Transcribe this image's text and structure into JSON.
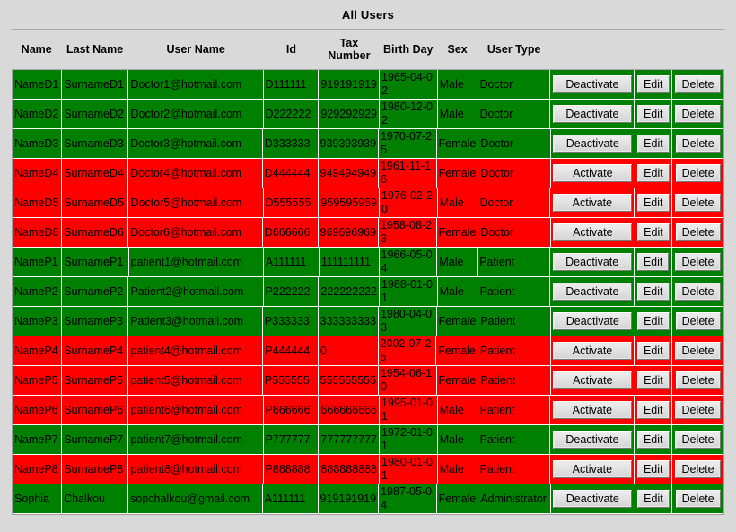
{
  "window": {
    "title": "All Users"
  },
  "colors": {
    "active_row": "#008000",
    "inactive_row": "#ff0000",
    "page_background": "#d9d9d9",
    "button_face": "#d4d0c8"
  },
  "table": {
    "columns": [
      {
        "key": "name",
        "label": "Name"
      },
      {
        "key": "last_name",
        "label": "Last Name"
      },
      {
        "key": "user_name",
        "label": "User Name"
      },
      {
        "key": "id",
        "label": "Id"
      },
      {
        "key": "tax",
        "label": "Tax Number"
      },
      {
        "key": "birth",
        "label": "Birth Day"
      },
      {
        "key": "sex",
        "label": "Sex"
      },
      {
        "key": "user_type",
        "label": "User Type"
      },
      {
        "key": "activate",
        "label": ""
      },
      {
        "key": "edit",
        "label": ""
      },
      {
        "key": "delete",
        "label": ""
      }
    ],
    "labels": {
      "activate": "Activate",
      "deactivate": "Deactivate",
      "edit": "Edit",
      "delete": "Delete"
    },
    "rows": [
      {
        "name": "NameD1",
        "last_name": "SurnameD1",
        "user_name": "Doctor1@hotmail.com",
        "id": "D111111",
        "tax": "919191919",
        "birth": "1965-04-02",
        "sex": "Male",
        "user_type": "Doctor",
        "status": "active",
        "action_label": "Deactivate"
      },
      {
        "name": "NameD2",
        "last_name": "SurnameD2",
        "user_name": "Doctor2@hotmail.com",
        "id": "D222222",
        "tax": "929292929",
        "birth": "1980-12-02",
        "sex": "Male",
        "user_type": "Doctor",
        "status": "active",
        "action_label": "Deactivate"
      },
      {
        "name": "NameD3",
        "last_name": "SurnameD3",
        "user_name": "Doctor3@hotmail.com",
        "id": "D333333",
        "tax": "939393939",
        "birth": "1970-07-25",
        "sex": "Female",
        "user_type": "Doctor",
        "status": "active",
        "action_label": "Deactivate"
      },
      {
        "name": "NameD4",
        "last_name": "SurnameD4",
        "user_name": "Doctor4@hotmail.com",
        "id": "D444444",
        "tax": "949494949",
        "birth": "1961-11-16",
        "sex": "Female",
        "user_type": "Doctor",
        "status": "inactive",
        "action_label": "Activate"
      },
      {
        "name": "NameD5",
        "last_name": "SurnameD5",
        "user_name": "Doctor5@hotmail.com",
        "id": "D555555",
        "tax": "959595959",
        "birth": "1976-02-20",
        "sex": "Male",
        "user_type": "Doctor",
        "status": "inactive",
        "action_label": "Activate"
      },
      {
        "name": "NameD6",
        "last_name": "SurnameD6",
        "user_name": "Doctor6@hotmail.com",
        "id": "D666666",
        "tax": "969696969",
        "birth": "1958-08-23",
        "sex": "Female",
        "user_type": "Doctor",
        "status": "inactive",
        "action_label": "Activate"
      },
      {
        "name": "NameP1",
        "last_name": "SurnameP1",
        "user_name": "patient1@hotmail.com",
        "id": "A111111",
        "tax": "111111111",
        "birth": "1966-05-04",
        "sex": "Male",
        "user_type": "Patient",
        "status": "active",
        "action_label": "Deactivate"
      },
      {
        "name": "NameP2",
        "last_name": "SurnameP2",
        "user_name": "Patient2@hotmail.com",
        "id": "P222222",
        "tax": "222222222",
        "birth": "1988-01-01",
        "sex": "Male",
        "user_type": "Patient",
        "status": "active",
        "action_label": "Deactivate"
      },
      {
        "name": "NameP3",
        "last_name": "SurnameP3",
        "user_name": "Patient3@hotmail.com",
        "id": "P333333",
        "tax": "333333333",
        "birth": "1980-04-03",
        "sex": "Female",
        "user_type": "Patient",
        "status": "active",
        "action_label": "Deactivate"
      },
      {
        "name": "NameP4",
        "last_name": "SurnameP4",
        "user_name": "patient4@hotmail.com",
        "id": "P444444",
        "tax": "0",
        "birth": "2002-07-25",
        "sex": "Female",
        "user_type": "Patient",
        "status": "inactive",
        "action_label": "Activate"
      },
      {
        "name": "NameP5",
        "last_name": "SurnameP5",
        "user_name": "patient5@hotmail.com",
        "id": "P555555",
        "tax": "555555555",
        "birth": "1954-06-10",
        "sex": "Female",
        "user_type": "Patient",
        "status": "inactive",
        "action_label": "Activate"
      },
      {
        "name": "NameP6",
        "last_name": "SurnameP6",
        "user_name": "patient6@hotmail.com",
        "id": "P666666",
        "tax": "666666666",
        "birth": "1995-01-01",
        "sex": "Male",
        "user_type": "Patient",
        "status": "inactive",
        "action_label": "Activate"
      },
      {
        "name": "NameP7",
        "last_name": "SurnameP7",
        "user_name": "patient7@hotmail.com",
        "id": "P777777",
        "tax": "777777777",
        "birth": "1972-01-01",
        "sex": "Male",
        "user_type": "Patient",
        "status": "active",
        "action_label": "Deactivate"
      },
      {
        "name": "NameP8",
        "last_name": "SurnameP8",
        "user_name": "patient8@hotmail.com",
        "id": "P888888",
        "tax": "888888888",
        "birth": "1980-01-01",
        "sex": "Male",
        "user_type": "Patient",
        "status": "inactive",
        "action_label": "Activate"
      },
      {
        "name": "Sophia",
        "last_name": "Chalkou",
        "user_name": "sopchalkou@gmail.com",
        "id": "A111111",
        "tax": "919191919",
        "birth": "1987-05-04",
        "sex": "Female",
        "user_type": "Administrator",
        "status": "active",
        "action_label": "Deactivate"
      }
    ]
  }
}
